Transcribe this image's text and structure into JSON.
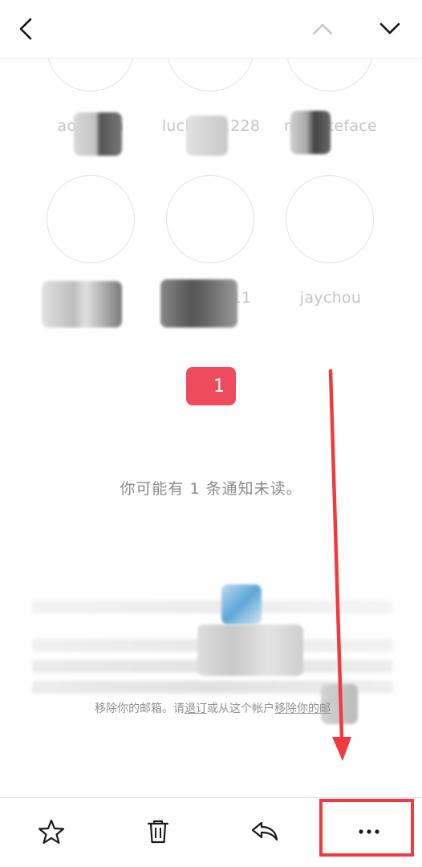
{
  "header": {
    "back_icon": "chevron-left-icon",
    "prev_icon": "chevron-up-icon",
    "next_icon": "chevron-down-icon"
  },
  "suggestions": {
    "row1": [
      "aoiyusta",
      "lucky_h1228",
      "miss_teface"
    ],
    "row2": [
      "",
      "jenny_811",
      "jaychou"
    ]
  },
  "notification": {
    "badge_count": "1",
    "unread_text": "你可能有 1 条通知未读。"
  },
  "footer": {
    "line_prefix": "移除你的邮箱。请",
    "unsubscribe_link": "退订",
    "line_middle": "或从这个帐户",
    "remove_link": "移除你的邮"
  },
  "toolbar": {
    "star_icon": "star-icon",
    "delete_icon": "trash-icon",
    "reply_icon": "reply-icon",
    "more_icon": "more-dots-icon"
  },
  "colors": {
    "badge": "#ee4b5c",
    "annotation": "#ef3b40"
  }
}
